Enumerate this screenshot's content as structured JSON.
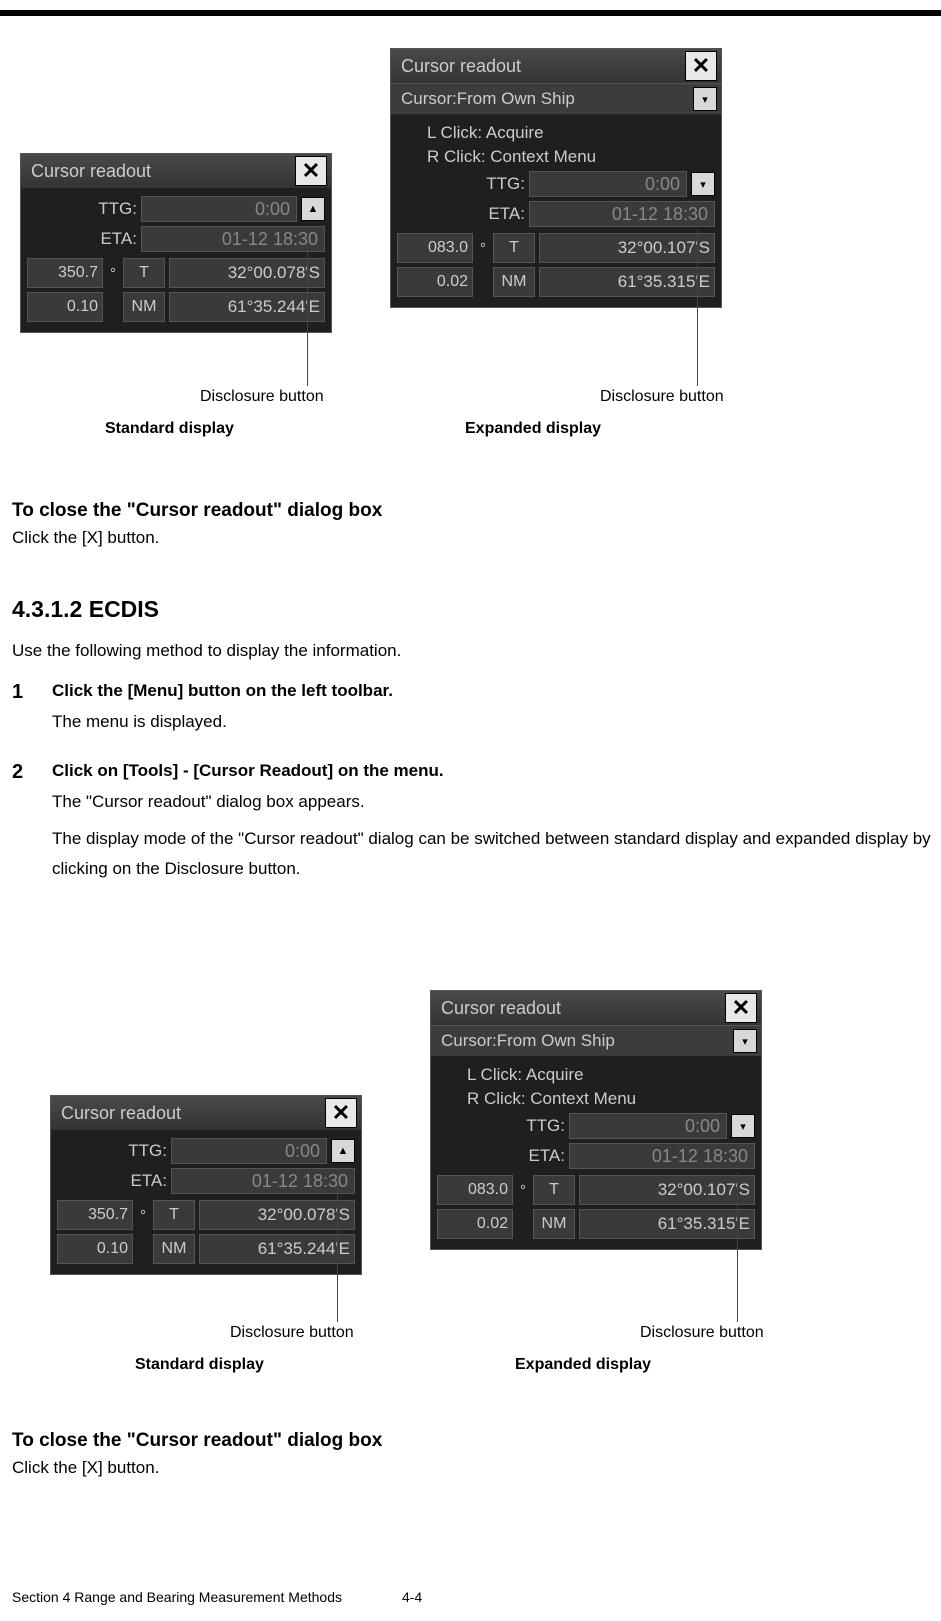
{
  "top_group": {
    "std": {
      "title": "Cursor readout",
      "ttg_label": "TTG:",
      "ttg_value": "0:00",
      "eta_label": "ETA:",
      "eta_value": "01-12 18:30",
      "brg": "350.7",
      "deg_sym": "°",
      "t_label": "T",
      "lat": "32°00.078'S",
      "rng": "0.10",
      "nm_label": "NM",
      "lon": "61°35.244'E",
      "disc_caption": "Disclosure button",
      "label": "Standard display"
    },
    "exp": {
      "title": "Cursor readout",
      "dropdown": "Cursor:From Own Ship",
      "hint1": "L Click: Acquire",
      "hint2": "R Click: Context Menu",
      "ttg_label": "TTG:",
      "ttg_value": "0:00",
      "eta_label": "ETA:",
      "eta_value": "01-12 18:30",
      "brg": "083.0",
      "deg_sym": "°",
      "t_label": "T",
      "lat": "32°00.107'S",
      "rng": "0.02",
      "nm_label": "NM",
      "lon": "61°35.315'E",
      "disc_caption": "Disclosure button",
      "label": "Expanded display"
    }
  },
  "text": {
    "close_heading_1": "To close the \"Cursor readout\" dialog box",
    "close_body_1": "Click the [X] button.",
    "section_heading": "4.3.1.2     ECDIS",
    "section_intro": "Use the following method to display the information.",
    "step1_num": "1",
    "step1_title": "Click the [Menu] button on the left toolbar.",
    "step1_body": "The menu is displayed.",
    "step2_num": "2",
    "step2_title": "Click on [Tools] - [Cursor Readout] on the menu.",
    "step2_body_a": "The \"Cursor readout\" dialog box appears.",
    "step2_body_b": "The display mode of the \"Cursor readout\" dialog can be switched between standard display and expanded display by clicking on the Disclosure button.",
    "close_heading_2": "To close the \"Cursor readout\" dialog box",
    "close_body_2": "Click the [X] button."
  },
  "bot_group": {
    "std": {
      "title": "Cursor readout",
      "ttg_label": "TTG:",
      "ttg_value": "0:00",
      "eta_label": "ETA:",
      "eta_value": "01-12 18:30",
      "brg": "350.7",
      "deg_sym": "°",
      "t_label": "T",
      "lat": "32°00.078'S",
      "rng": "0.10",
      "nm_label": "NM",
      "lon": "61°35.244'E",
      "disc_caption": "Disclosure button",
      "label": "Standard display"
    },
    "exp": {
      "title": "Cursor readout",
      "dropdown": "Cursor:From Own Ship",
      "hint1": "L Click: Acquire",
      "hint2": "R Click: Context Menu",
      "ttg_label": "TTG:",
      "ttg_value": "0:00",
      "eta_label": "ETA:",
      "eta_value": "01-12 18:30",
      "brg": "083.0",
      "deg_sym": "°",
      "t_label": "T",
      "lat": "32°00.107'S",
      "rng": "0.02",
      "nm_label": "NM",
      "lon": "61°35.315'E",
      "disc_caption": "Disclosure button",
      "label": "Expanded display"
    }
  },
  "footer": {
    "section": "Section 4    Range and Bearing Measurement Methods",
    "page": "4-4"
  }
}
